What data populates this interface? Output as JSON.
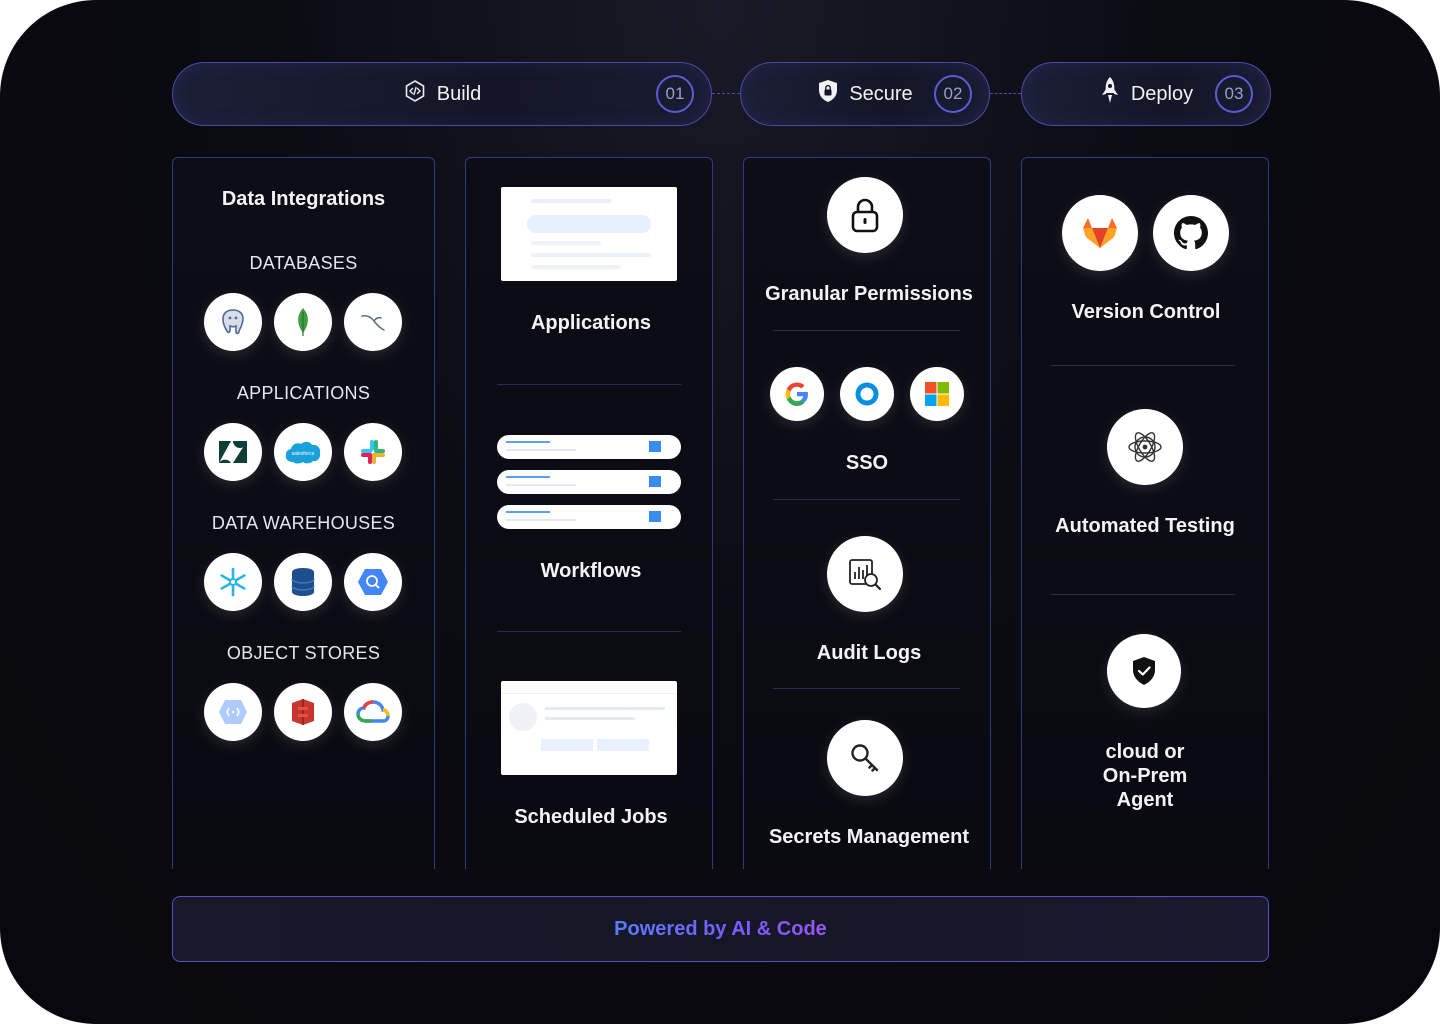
{
  "steps": [
    {
      "label": "Build",
      "num": "01",
      "icon": "code-shield-icon"
    },
    {
      "label": "Secure",
      "num": "02",
      "icon": "lock-shield-icon"
    },
    {
      "label": "Deploy",
      "num": "03",
      "icon": "rocket-icon"
    }
  ],
  "build_integrations": {
    "title": "Data Integrations",
    "sections": [
      {
        "label": "DATABASES",
        "icons": [
          "postgresql-icon",
          "mongodb-icon",
          "mysql-icon"
        ]
      },
      {
        "label": "APPLICATIONS",
        "icons": [
          "zendesk-icon",
          "salesforce-icon",
          "slack-icon"
        ]
      },
      {
        "label": "DATA WAREHOUSES",
        "icons": [
          "snowflake-icon",
          "database-icon",
          "bigquery-icon"
        ]
      },
      {
        "label": "OBJECT STORES",
        "icons": [
          "gcs-icon",
          "s3-icon",
          "google-cloud-icon"
        ]
      }
    ]
  },
  "build_features": {
    "applications": "Applications",
    "workflows": "Workflows",
    "scheduled_jobs": "Scheduled Jobs",
    "salesforce_logo_text": "salesforce"
  },
  "secure": {
    "granular_permissions": "Granular Permissions",
    "sso": "SSO",
    "audit_logs": "Audit Logs",
    "secrets_management": "Secrets Management"
  },
  "deploy": {
    "version_control": "Version Control",
    "automated_testing": "Automated Testing",
    "agent_line1": "cloud or",
    "agent_line2": "On-Prem",
    "agent_line3": "Agent"
  },
  "footer": {
    "text": "Powered by AI & Code"
  },
  "colors": {
    "background": "#0b0b12",
    "pill_border": "#4a4aa8",
    "column_border": "#2f3a86",
    "accent_blue": "#5a7cff",
    "accent_purple": "#9a55f0"
  }
}
